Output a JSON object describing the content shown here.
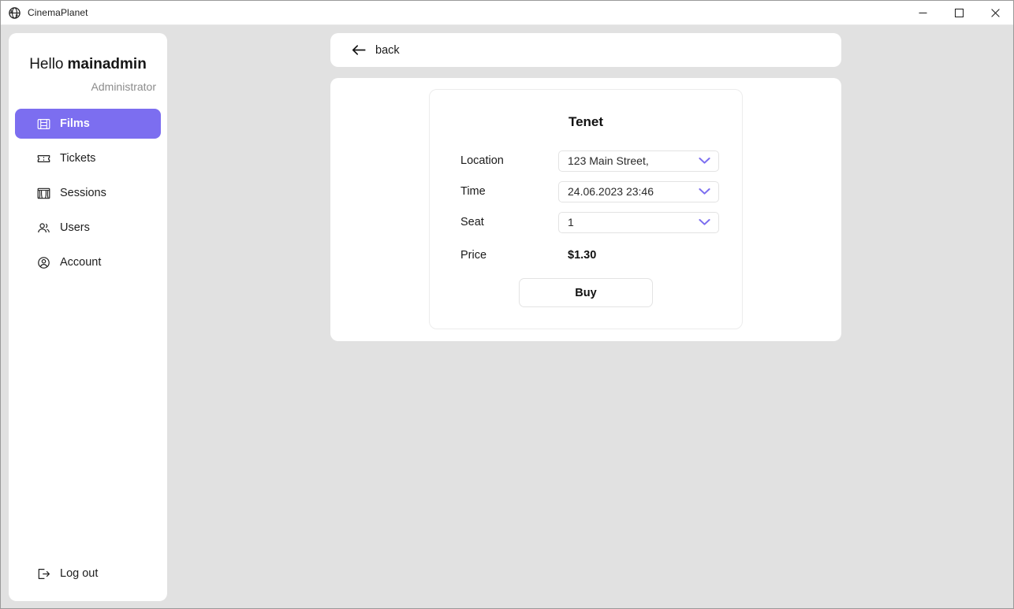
{
  "window": {
    "app_icon": "globe-icon",
    "title": "CinemaPlanet",
    "controls": {
      "minimize": "minimize-icon",
      "maximize": "maximize-icon",
      "close": "close-icon"
    }
  },
  "sidebar": {
    "greeting_hello": "Hello",
    "username": "mainadmin",
    "role": "Administrator",
    "items": [
      {
        "label": "Films",
        "icon": "film-icon",
        "active": true
      },
      {
        "label": "Tickets",
        "icon": "ticket-icon",
        "active": false
      },
      {
        "label": "Sessions",
        "icon": "curtain-icon",
        "active": false
      },
      {
        "label": "Users",
        "icon": "users-icon",
        "active": false
      },
      {
        "label": "Account",
        "icon": "account-icon",
        "active": false
      }
    ],
    "logout": {
      "label": "Log out",
      "icon": "logout-icon"
    }
  },
  "topbar": {
    "back_label": "back",
    "back_icon": "arrow-left-icon"
  },
  "booking": {
    "film_title": "Tenet",
    "fields": [
      {
        "label": "Location",
        "value": "123 Main Street,",
        "icon": "chevron-down-icon"
      },
      {
        "label": "Time",
        "value": "24.06.2023 23:46",
        "icon": "chevron-down-icon"
      },
      {
        "label": "Seat",
        "value": "1",
        "icon": "chevron-down-icon"
      }
    ],
    "price_label": "Price",
    "price_value": "$1.30",
    "buy_label": "Buy"
  },
  "colors": {
    "accent": "#7c6ef0",
    "app_background": "#e1e1e1",
    "card": "#ffffff",
    "muted_text": "#8c8c8c"
  }
}
